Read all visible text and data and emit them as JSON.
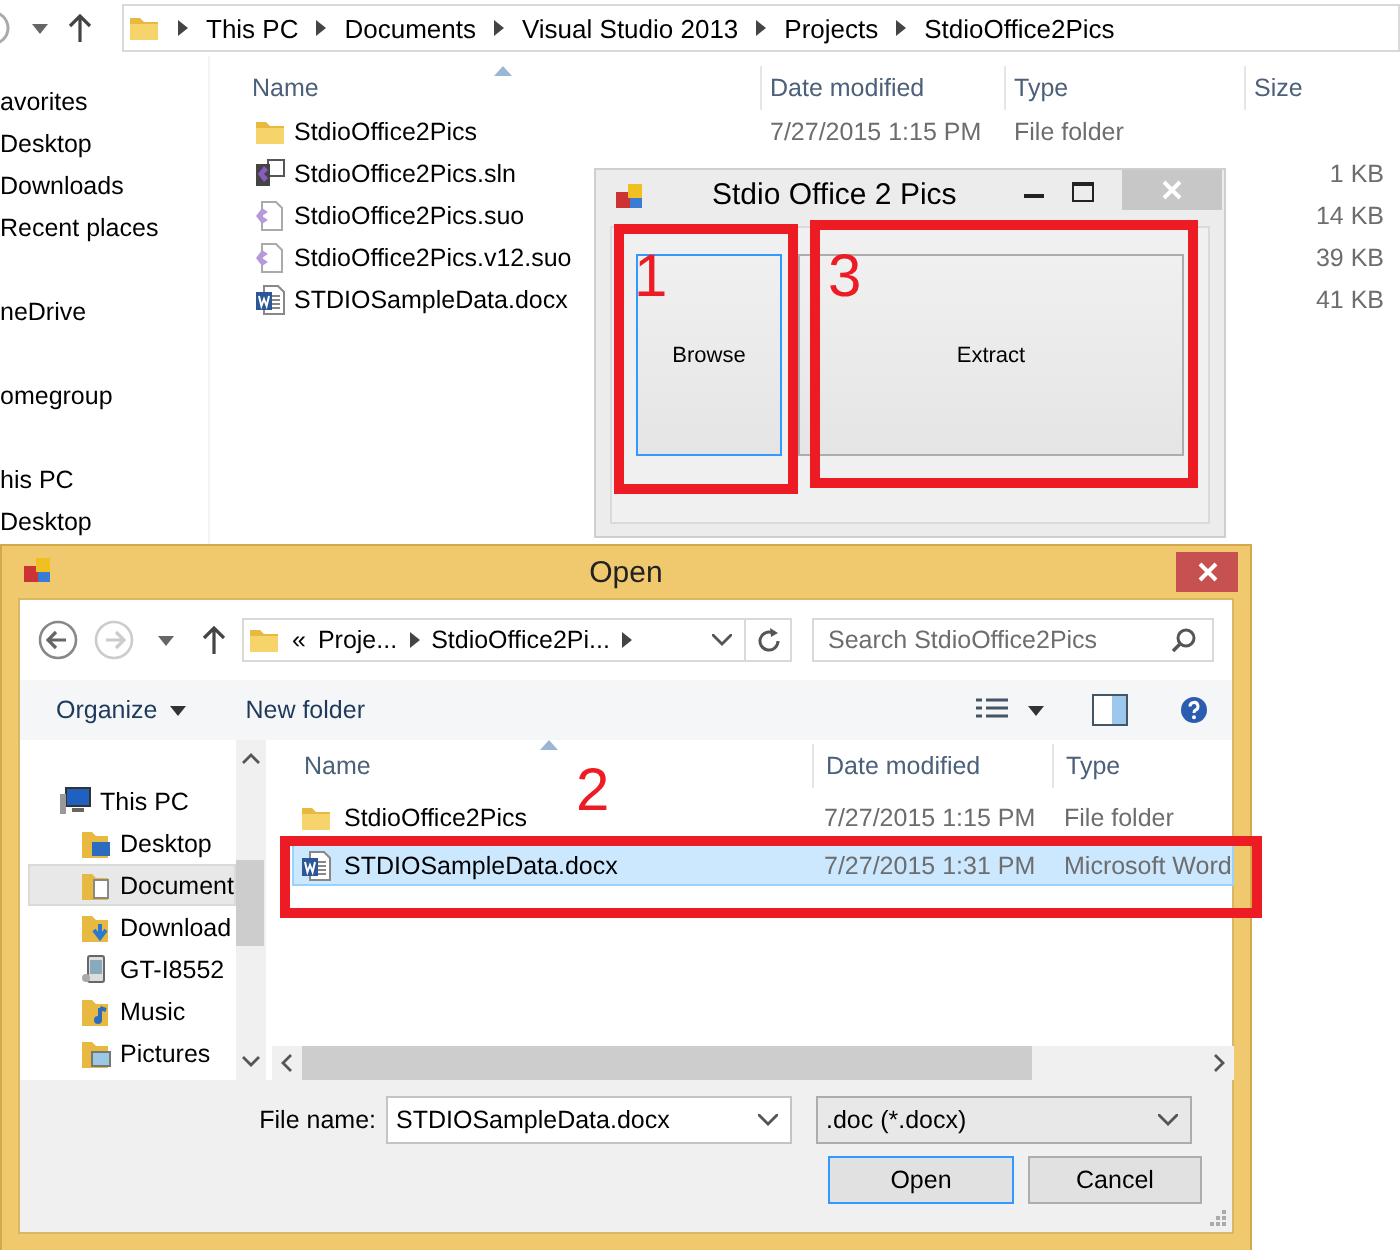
{
  "explorer": {
    "breadcrumb": [
      "This PC",
      "Documents",
      "Visual Studio 2013",
      "Projects",
      "StdioOffice2Pics"
    ],
    "sidebar": [
      {
        "label": "avorites",
        "children": [
          {
            "label": "Desktop"
          },
          {
            "label": "Downloads"
          },
          {
            "label": "Recent places"
          }
        ]
      },
      {
        "label": "neDrive"
      },
      {
        "label": "omegroup"
      },
      {
        "label": "his PC",
        "children": [
          {
            "label": "Desktop"
          }
        ]
      }
    ],
    "columns": [
      "Name",
      "Date modified",
      "Type",
      "Size"
    ],
    "files": [
      {
        "kind": "folder",
        "name": "StdioOffice2Pics",
        "date": "7/27/2015 1:15 PM",
        "type": "File folder"
      },
      {
        "kind": "solution",
        "name": "StdioOffice2Pics.sln",
        "size": "1 KB"
      },
      {
        "kind": "options",
        "name": "StdioOffice2Pics.suo",
        "size": "14 KB"
      },
      {
        "kind": "options",
        "name": "StdioOffice2Pics.v12.suo",
        "size": "39 KB"
      },
      {
        "kind": "word",
        "name": "STDIOSampleData.docx",
        "size": "41 KB"
      }
    ]
  },
  "app_window": {
    "title": "Stdio Office 2 Pics",
    "buttons": [
      {
        "label": "Browse",
        "focused": true
      },
      {
        "label": "Extract",
        "focused": false
      }
    ]
  },
  "open_dialog": {
    "title": "Open",
    "overflow": "«",
    "address": [
      "Proje...",
      "StdioOffice2Pi..."
    ],
    "search": {
      "placeholder": "Search StdioOffice2Pics"
    },
    "toolbar": [
      "Organize",
      "New folder"
    ],
    "nav": [
      {
        "label": "This PC",
        "kind": "pc",
        "selected": false,
        "children": [
          {
            "label": "Desktop",
            "kind": "desktop",
            "selected": false
          },
          {
            "label": "Document",
            "kind": "documents",
            "selected": true
          },
          {
            "label": "Download",
            "kind": "downloads",
            "selected": false
          },
          {
            "label": "GT-I8552",
            "kind": "phone",
            "selected": false
          },
          {
            "label": "Music",
            "kind": "music",
            "selected": false
          },
          {
            "label": "Pictures",
            "kind": "pictures",
            "selected": false
          }
        ]
      }
    ],
    "columns": [
      "Name",
      "Date modified",
      "Type"
    ],
    "files": [
      {
        "kind": "folder",
        "name": "StdioOffice2Pics",
        "date": "7/27/2015 1:15 PM",
        "type": "File folder",
        "selected": false
      },
      {
        "kind": "word",
        "name": "STDIOSampleData.docx",
        "date": "7/27/2015 1:31 PM",
        "type": "Microsoft Word",
        "selected": true
      }
    ],
    "file_name_label": "File name:",
    "file_name": "STDIOSampleData.docx",
    "file_type": ".doc (*.docx)",
    "buttons": [
      {
        "label": "Open",
        "default": true
      },
      {
        "label": "Cancel",
        "default": false
      }
    ]
  },
  "annotations": [
    {
      "number": "1"
    },
    {
      "number": "2"
    },
    {
      "number": "3"
    }
  ]
}
